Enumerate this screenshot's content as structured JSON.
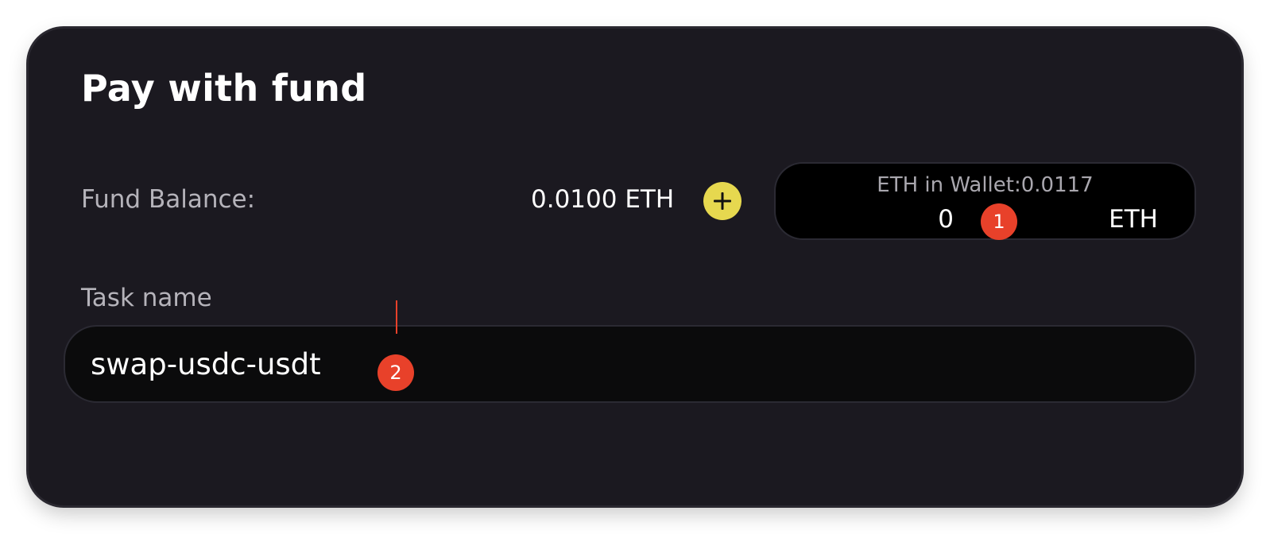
{
  "panel": {
    "title": "Pay with fund",
    "fund_balance_label": "Fund Balance:",
    "fund_balance_value": "0.0100 ETH",
    "add_icon": "plus-icon",
    "wallet": {
      "label": "ETH in Wallet:0.0117",
      "amount_value": "0",
      "unit": "ETH"
    },
    "task_name_label": "Task name",
    "task_name_value": "swap-usdc-usdt"
  },
  "annotations": {
    "marker_1": "1",
    "marker_2": "2"
  },
  "colors": {
    "card_background": "#1b1920",
    "accent_yellow": "#e6d84f",
    "marker_red": "#e8412a"
  }
}
